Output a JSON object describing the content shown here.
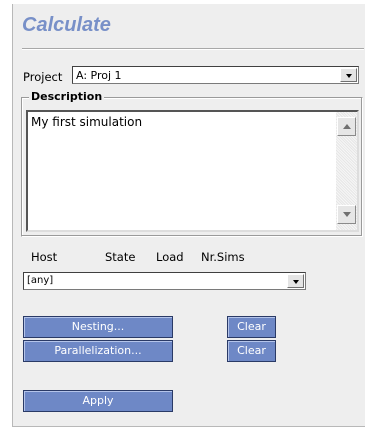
{
  "title": "Calculate",
  "project": {
    "label": "Project",
    "value": "A: Proj 1"
  },
  "description": {
    "legend": "Description",
    "text": "My first simulation"
  },
  "host_table": {
    "headers": [
      "Host",
      "State",
      "Load",
      "Nr.Sims"
    ],
    "host_value": "[any]"
  },
  "buttons": {
    "nesting": "Nesting...",
    "nesting_clear": "Clear",
    "parallelization": "Parallelization...",
    "parallelization_clear": "Clear",
    "apply": "Apply"
  },
  "icons": {
    "dropdown": "chevron-down-icon",
    "scroll_up": "scroll-up-icon",
    "scroll_down": "scroll-down-icon"
  },
  "colors": {
    "title": "#7890c8",
    "button_bg": "#6e88c6",
    "panel_bg": "#eeeeee"
  }
}
